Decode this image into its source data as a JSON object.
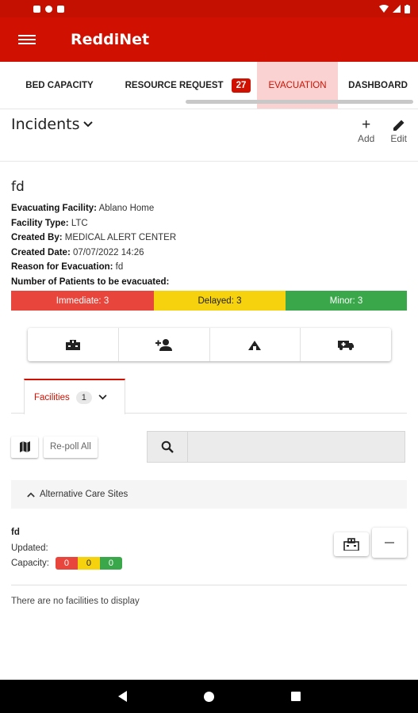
{
  "app": {
    "title": "ReddiNet"
  },
  "tabs": [
    {
      "label": "BED CAPACITY"
    },
    {
      "label": "RESOURCE REQUEST",
      "badge": "27"
    },
    {
      "label": "EVACUATION"
    },
    {
      "label": "DASHBOARD"
    }
  ],
  "incidents": {
    "title": "Incidents",
    "add_label": "Add",
    "edit_label": "Edit"
  },
  "incident": {
    "name": "fd",
    "fields": [
      {
        "label": "Evacuating Facility:",
        "value": "Ablano Home"
      },
      {
        "label": "Facility Type:",
        "value": "LTC"
      },
      {
        "label": "Created By:",
        "value": "MEDICAL ALERT CENTER"
      },
      {
        "label": "Created Date:",
        "value": "07/07/2022 14:26"
      },
      {
        "label": "Reason for Evacuation:",
        "value": "fd"
      },
      {
        "label": "Number of Patients to be evacuated:",
        "value": ""
      }
    ],
    "triage": {
      "immediate": "Immediate: 3",
      "delayed": "Delayed: 3",
      "minor": "Minor: 3"
    }
  },
  "icons": [
    "hospital-icon",
    "add-person-icon",
    "shelter-icon",
    "ambulance-icon"
  ],
  "facilities_tab": {
    "label": "Facilities",
    "count": "1"
  },
  "toolbar": {
    "repoll_label": "Re-poll All",
    "search_placeholder": ""
  },
  "acs": {
    "label": "Alternative Care Sites"
  },
  "facility": {
    "name": "fd",
    "updated_label": "Updated:",
    "capacity_label": "Capacity:",
    "capacity": {
      "red": "0",
      "yellow": "0",
      "green": "0"
    }
  },
  "empty_message": "There are no facilities to display",
  "colors": {
    "brand_red": "#d01000",
    "immediate": "#e8453c",
    "delayed": "#f6d20e",
    "minor": "#3aa84a"
  }
}
